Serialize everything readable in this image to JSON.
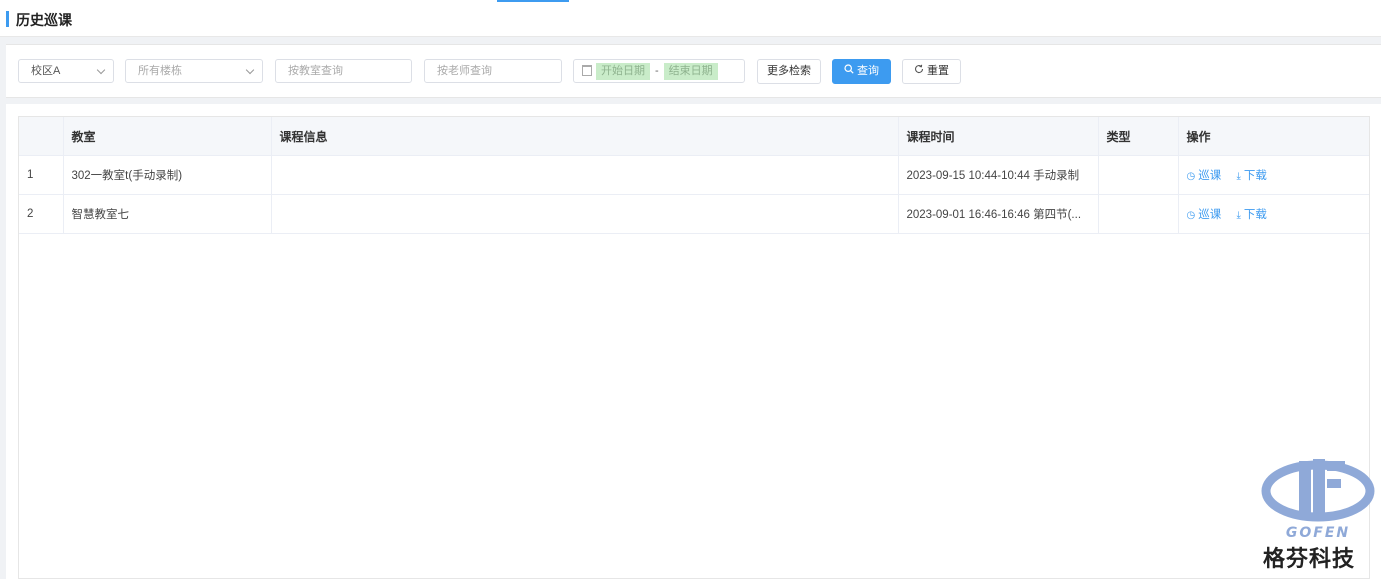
{
  "page": {
    "title": "历史巡课"
  },
  "filters": {
    "campus": "校区A",
    "building_placeholder": "所有楼栋",
    "classroom_placeholder": "按教室查询",
    "teacher_placeholder": "按老师查询",
    "start_date_placeholder": "开始日期",
    "date_separator": "-",
    "end_date_placeholder": "结束日期",
    "more_search_label": "更多检索",
    "search_label": "查询",
    "reset_label": "重置"
  },
  "table": {
    "columns": [
      "",
      "教室",
      "课程信息",
      "课程时间",
      "类型",
      "操作"
    ],
    "rows": [
      {
        "index": "1",
        "classroom": "302一教室t(手动录制)",
        "course_info": "",
        "course_time": "2023-09-15 10:44-10:44 手动录制",
        "type": ""
      },
      {
        "index": "2",
        "classroom": "智慧教室七",
        "course_info": "",
        "course_time": "2023-09-01 16:46-16:46 第四节(...",
        "type": ""
      }
    ],
    "actions": {
      "patrol_label": "巡课",
      "download_label": "下载"
    }
  },
  "watermark": {
    "brand_en": "GOFEN",
    "brand_cn": "格芬科技"
  },
  "colors": {
    "accent": "#3d9bf0",
    "date_highlight": "#c9ecc9",
    "logo_blue": "#8fa9d8"
  }
}
